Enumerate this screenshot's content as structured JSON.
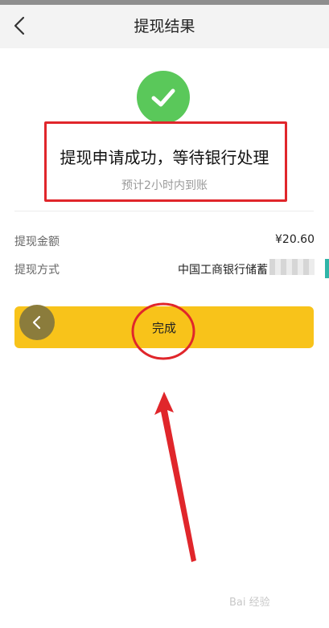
{
  "header": {
    "title": "提现结果"
  },
  "result": {
    "title": "提现申请成功，等待银行处理",
    "subtitle": "预计2小时内到账"
  },
  "details": [
    {
      "label": "提现金额",
      "value": "¥20.60"
    },
    {
      "label": "提现方式",
      "value": "中国工商银行储蓄"
    }
  ],
  "actions": {
    "done_label": "完成"
  },
  "watermark": "Bai 经验",
  "colors": {
    "accent_yellow": "#f8c31a",
    "success_green": "#5ac85a",
    "annotation_red": "#e0262b"
  }
}
